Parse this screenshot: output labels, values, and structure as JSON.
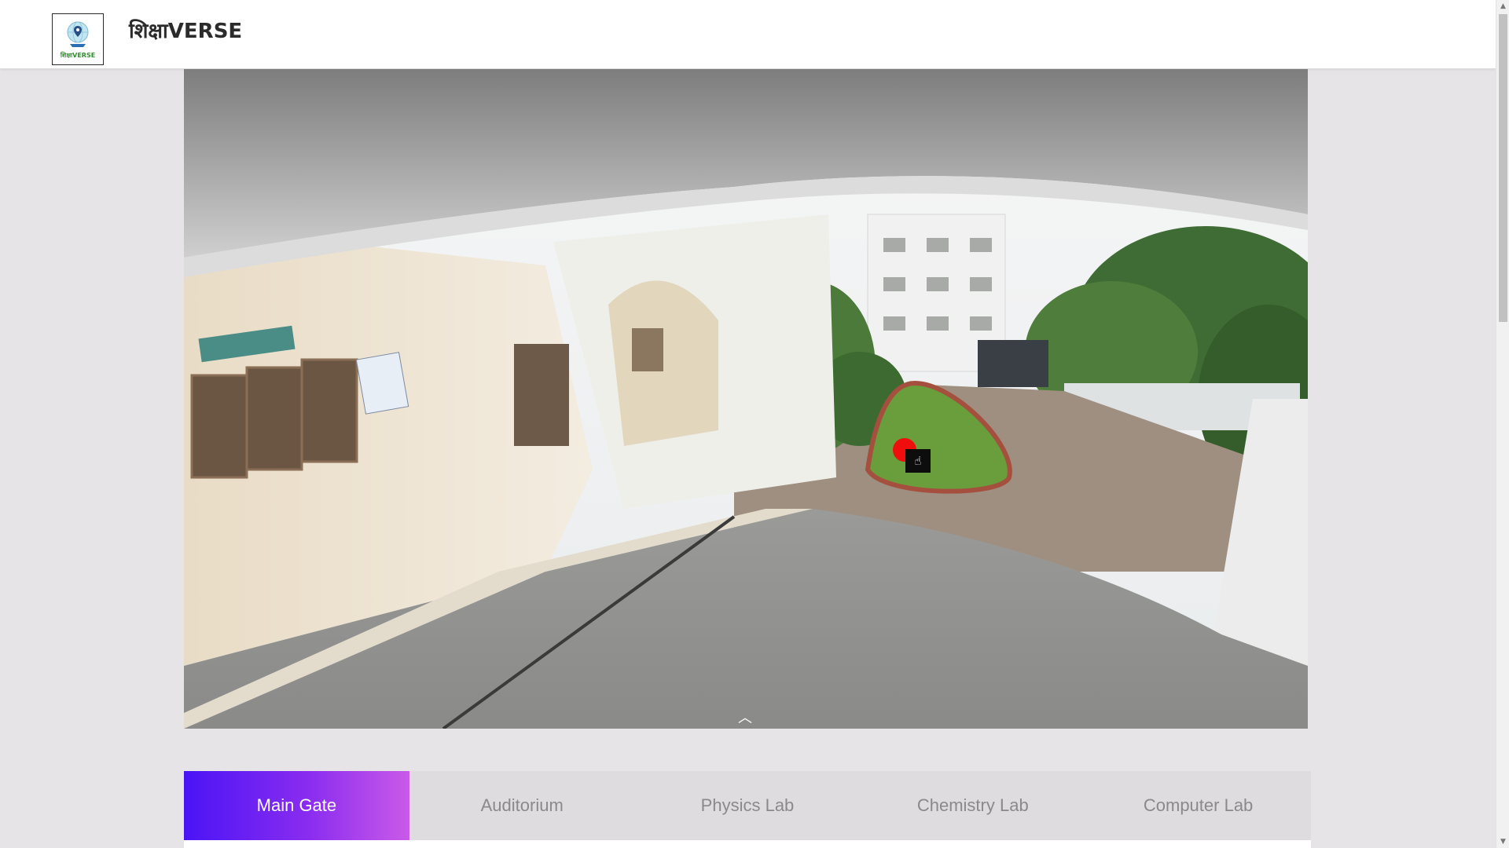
{
  "header": {
    "logo_text_main": "शिक्षा",
    "logo_text_accent": "VERSE",
    "brand_title": "शिक्षाVERSE"
  },
  "viewer": {
    "icons": [
      "hand-pointer-icon",
      "chevron-up-icon"
    ],
    "colors": {
      "hotspot": "#ef0d0d"
    }
  },
  "tabs": {
    "items": [
      {
        "label": "Main Gate",
        "active": true
      },
      {
        "label": "Auditorium",
        "active": false
      },
      {
        "label": "Physics Lab",
        "active": false
      },
      {
        "label": "Chemistry Lab",
        "active": false
      },
      {
        "label": "Computer Lab",
        "active": false
      }
    ],
    "colors": {
      "active_start": "#4a14f5",
      "active_end": "#c95ae8",
      "inactive_text": "#8a8a8a"
    }
  }
}
